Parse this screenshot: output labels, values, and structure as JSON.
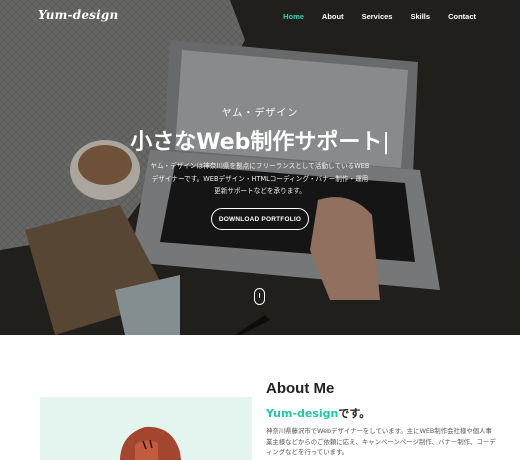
{
  "nav": {
    "logo": "Yum-design",
    "links": [
      "Home",
      "About",
      "Services",
      "Skills",
      "Contact"
    ],
    "active": "Home"
  },
  "hero": {
    "subtitle": "ヤム・デザイン",
    "title": "小さなWeb制作サポート",
    "cursor": "|",
    "description": "ヤム・デザインは神奈川県を拠点にフリーランスとして活動しているWEBデザイナーです。WEBデザイン・HTMLコーディング・バナー制作・運用更新サポートなどを承ります。",
    "button": "DOWNLOAD PORTFOLIO",
    "scroll_icon": "mouse-scroll-icon"
  },
  "about": {
    "title": "About Me",
    "name_brand": "Yum-design",
    "name_suffix": "です。",
    "text": "神奈川県藤沢市でWebデザイナーをしています。主にWEB制作会社様や個人事業主様などからのご依頼に応え、キャンペーンページ制作、バナー制作、コーディングなどを行っています。"
  },
  "colors": {
    "accent": "#2ed3b7",
    "brand": "#1fc6a7"
  }
}
